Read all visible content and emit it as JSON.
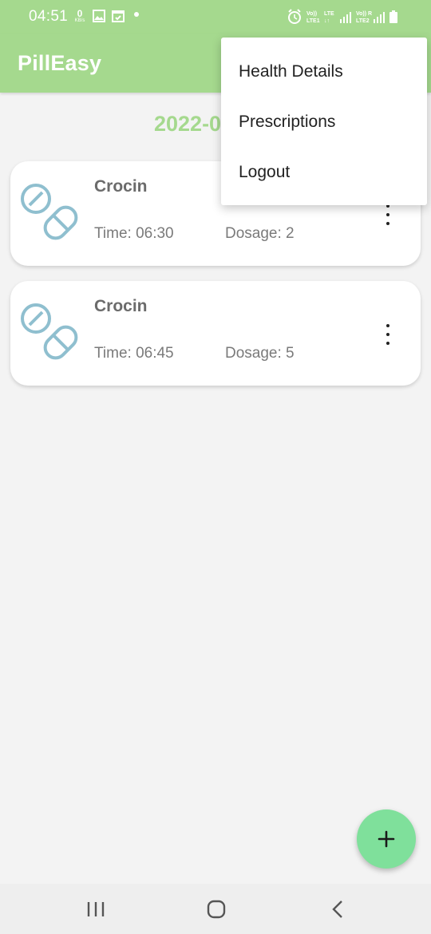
{
  "status_bar": {
    "time": "04:51",
    "net_speed_value": "0",
    "net_speed_unit": "KB/s",
    "icons": [
      "gallery-icon",
      "calendar-check-icon",
      "notification-dot-icon",
      "alarm-icon",
      "volte-lte1-icon",
      "signal-icon",
      "volte-lte2-icon",
      "signal-icon",
      "battery-icon"
    ]
  },
  "app_bar": {
    "title": "PillEasy"
  },
  "date_heading": "2022-0",
  "medicines": [
    {
      "name": "Crocin",
      "time_text": "Time: 06:30",
      "dosage_text": "Dosage: 2",
      "icon": "pill-icon"
    },
    {
      "name": "Crocin",
      "time_text": "Time: 06:45",
      "dosage_text": "Dosage: 5",
      "icon": "pill-icon"
    }
  ],
  "overflow_menu": {
    "items": [
      {
        "label": "Health Details"
      },
      {
        "label": "Prescriptions"
      },
      {
        "label": "Logout"
      }
    ]
  },
  "fab": {
    "icon": "plus-icon"
  },
  "nav_bar": {
    "buttons": [
      "recent-apps-icon",
      "home-icon",
      "back-icon"
    ]
  },
  "colors": {
    "primary": "#a5d98e",
    "fab": "#7fe09b",
    "pill_icon": "#8fbfcf",
    "background": "#f3f3f3"
  }
}
